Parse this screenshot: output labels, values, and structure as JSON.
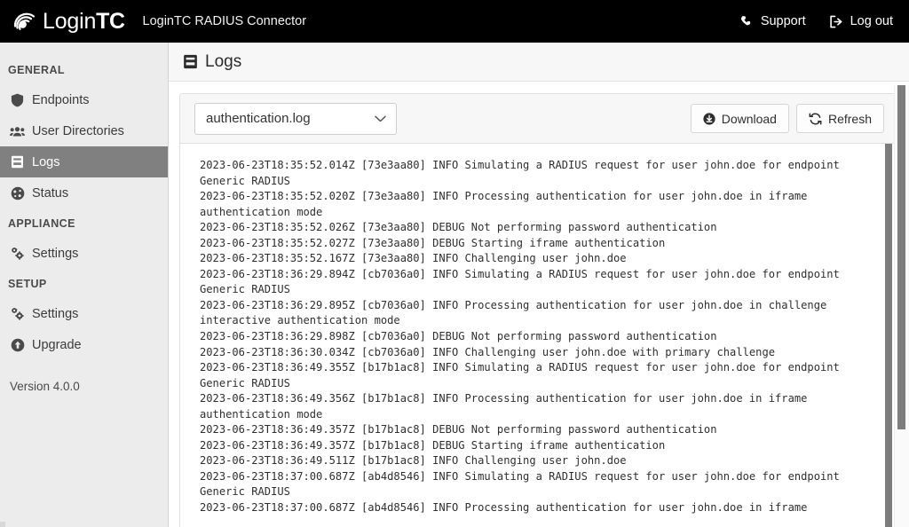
{
  "topbar": {
    "brand_login": "Login",
    "brand_tc": "TC",
    "app_title": "LoginTC RADIUS Connector",
    "support_label": "Support",
    "logout_label": "Log out",
    "background": "#000000"
  },
  "sidebar": {
    "sections": [
      {
        "label": "GENERAL",
        "items": [
          {
            "label": "Endpoints",
            "icon": "shield-icon",
            "active": false
          },
          {
            "label": "User Directories",
            "icon": "users-icon",
            "active": false
          },
          {
            "label": "Logs",
            "icon": "book-icon",
            "active": true
          },
          {
            "label": "Status",
            "icon": "gauge-icon",
            "active": false
          }
        ]
      },
      {
        "label": "APPLIANCE",
        "items": [
          {
            "label": "Settings",
            "icon": "gears-icon",
            "active": false
          }
        ]
      },
      {
        "label": "SETUP",
        "items": [
          {
            "label": "Settings",
            "icon": "gears-icon",
            "active": false
          },
          {
            "label": "Upgrade",
            "icon": "upgrade-arrow-icon",
            "active": false
          }
        ]
      }
    ],
    "version": "Version 4.0.0",
    "active_background": "#808080",
    "background": "#ececec"
  },
  "page": {
    "title": "Logs",
    "title_icon": "book-icon"
  },
  "toolbar": {
    "select_value": "authentication.log",
    "select_options": [
      "authentication.log"
    ],
    "download_label": "Download",
    "download_icon": "download-circle-icon",
    "refresh_label": "Refresh",
    "refresh_icon": "refresh-icon"
  },
  "log": {
    "content": "2023-06-23T18:35:52.014Z [73e3aa80] INFO Simulating a RADIUS request for user john.doe for endpoint Generic RADIUS\n2023-06-23T18:35:52.020Z [73e3aa80] INFO Processing authentication for user john.doe in iframe authentication mode\n2023-06-23T18:35:52.026Z [73e3aa80] DEBUG Not performing password authentication\n2023-06-23T18:35:52.027Z [73e3aa80] DEBUG Starting iframe authentication\n2023-06-23T18:35:52.167Z [73e3aa80] INFO Challenging user john.doe\n2023-06-23T18:36:29.894Z [cb7036a0] INFO Simulating a RADIUS request for user john.doe for endpoint Generic RADIUS\n2023-06-23T18:36:29.895Z [cb7036a0] INFO Processing authentication for user john.doe in challenge interactive authentication mode\n2023-06-23T18:36:29.898Z [cb7036a0] DEBUG Not performing password authentication\n2023-06-23T18:36:30.034Z [cb7036a0] INFO Challenging user john.doe with primary challenge\n2023-06-23T18:36:49.355Z [b17b1ac8] INFO Simulating a RADIUS request for user john.doe for endpoint Generic RADIUS\n2023-06-23T18:36:49.356Z [b17b1ac8] INFO Processing authentication for user john.doe in iframe authentication mode\n2023-06-23T18:36:49.357Z [b17b1ac8] DEBUG Not performing password authentication\n2023-06-23T18:36:49.357Z [b17b1ac8] DEBUG Starting iframe authentication\n2023-06-23T18:36:49.511Z [b17b1ac8] INFO Challenging user john.doe\n2023-06-23T18:37:00.687Z [ab4d8546] INFO Simulating a RADIUS request for user john.doe for endpoint Generic RADIUS\n2023-06-23T18:37:00.687Z [ab4d8546] INFO Processing authentication for user john.doe in iframe"
  }
}
